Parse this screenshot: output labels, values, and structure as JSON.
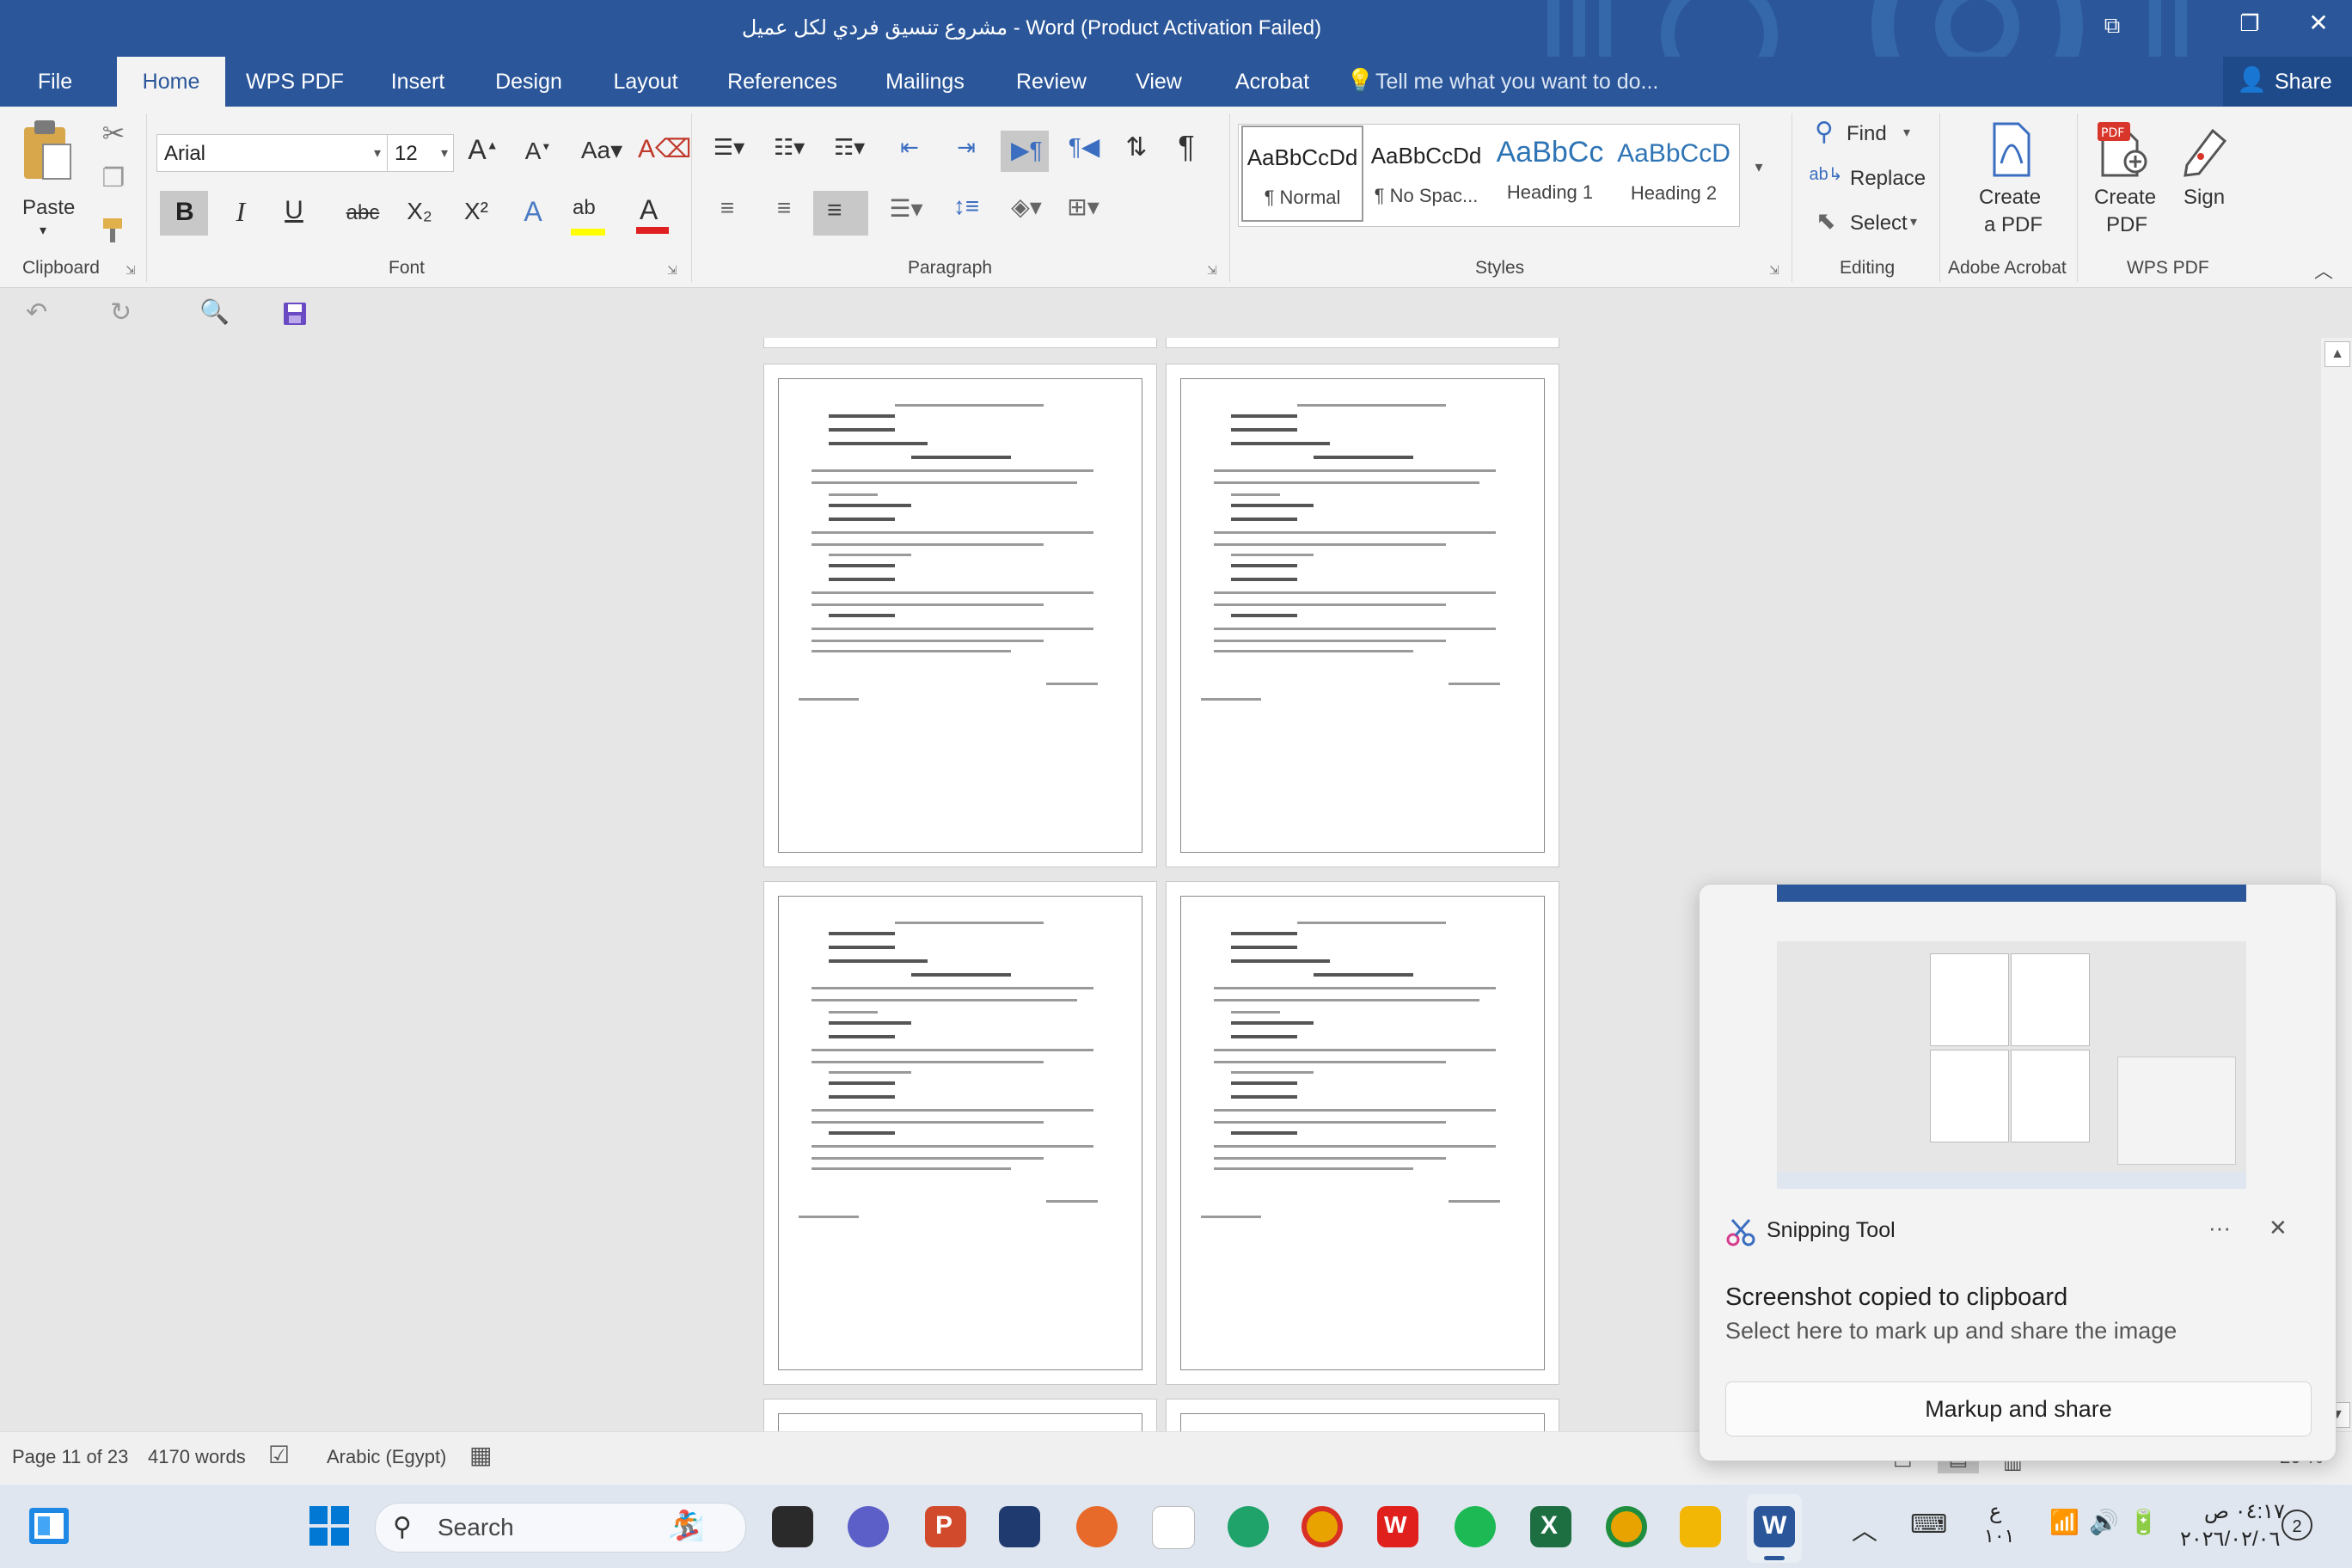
{
  "window": {
    "title": "مشروع تنسيق فردي لكل عميل - Word (Product Activation Failed)",
    "share_label": "Share"
  },
  "tabs": [
    {
      "label": "File"
    },
    {
      "label": "Home"
    },
    {
      "label": "WPS PDF"
    },
    {
      "label": "Insert"
    },
    {
      "label": "Design"
    },
    {
      "label": "Layout"
    },
    {
      "label": "References"
    },
    {
      "label": "Mailings"
    },
    {
      "label": "Review"
    },
    {
      "label": "View"
    },
    {
      "label": "Acrobat"
    }
  ],
  "tell_me": "Tell me what you want to do...",
  "ribbon": {
    "clipboard": {
      "paste": "Paste",
      "group": "Clipboard"
    },
    "font": {
      "name": "Arial",
      "size": "12",
      "group": "Font",
      "bold": "B",
      "italic": "I",
      "underline": "U",
      "strike": "abc",
      "sub": "X₂",
      "sup": "X²"
    },
    "paragraph": {
      "group": "Paragraph"
    },
    "styles": {
      "group": "Styles",
      "items": [
        {
          "preview": "AaBbCcDd",
          "name": "¶ Normal"
        },
        {
          "preview": "AaBbCcDd",
          "name": "¶ No Spac..."
        },
        {
          "preview": "AaBbCc",
          "name": "Heading 1"
        },
        {
          "preview": "AaBbCcD",
          "name": "Heading 2"
        }
      ]
    },
    "editing": {
      "find": "Find",
      "replace": "Replace",
      "select": "Select",
      "group": "Editing"
    },
    "acrobat": {
      "create": "Create",
      "create2": "a PDF",
      "group": "Adobe Acrobat"
    },
    "wps": {
      "create": "Create",
      "create2": "PDF",
      "sign": "Sign",
      "group": "WPS PDF"
    }
  },
  "status": {
    "page": "Page 11 of 23",
    "words": "4170 words",
    "language": "Arabic (Egypt)",
    "zoom": "20 %"
  },
  "taskbar": {
    "search": "Search",
    "lang": "ع",
    "lang2": "١٠١",
    "time": "٠٤:١٧ ص",
    "date": "٢٠٢٦/٠٢/٠٦",
    "badge": "2"
  },
  "toast": {
    "app": "Snipping Tool",
    "title": "Screenshot copied to clipboard",
    "body": "Select here to mark up and share the image",
    "button": "Markup and share",
    "more": "···"
  },
  "colors": {
    "accent": "#2b579a"
  }
}
